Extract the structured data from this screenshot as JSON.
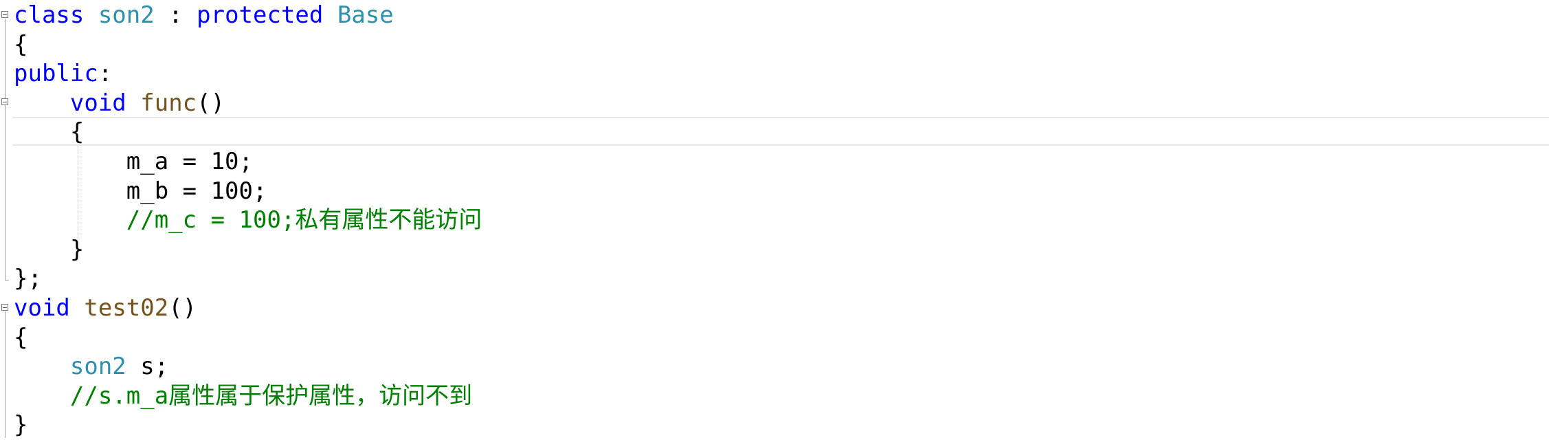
{
  "code": {
    "lines": [
      [
        {
          "t": "class ",
          "c": "kw"
        },
        {
          "t": "son2",
          "c": "type"
        },
        {
          "t": " : ",
          "c": "plain"
        },
        {
          "t": "protected",
          "c": "kw"
        },
        {
          "t": " ",
          "c": "plain"
        },
        {
          "t": "Base",
          "c": "type"
        }
      ],
      [
        {
          "t": "{",
          "c": "plain"
        }
      ],
      [
        {
          "t": "public",
          "c": "kw"
        },
        {
          "t": ":",
          "c": "plain"
        }
      ],
      [
        {
          "t": "    ",
          "c": "plain"
        },
        {
          "t": "void",
          "c": "kw"
        },
        {
          "t": " ",
          "c": "plain"
        },
        {
          "t": "func",
          "c": "fn"
        },
        {
          "t": "()",
          "c": "plain"
        }
      ],
      [
        {
          "t": "    {",
          "c": "plain"
        }
      ],
      [
        {
          "t": "        m_a = 10;",
          "c": "plain"
        }
      ],
      [
        {
          "t": "        m_b = 100;",
          "c": "plain"
        }
      ],
      [
        {
          "t": "        ",
          "c": "plain"
        },
        {
          "t": "//m_c = 100;私有属性不能访问",
          "c": "cm"
        }
      ],
      [
        {
          "t": "    }",
          "c": "plain"
        }
      ],
      [
        {
          "t": "};",
          "c": "plain"
        }
      ],
      [
        {
          "t": "void",
          "c": "kw"
        },
        {
          "t": " ",
          "c": "plain"
        },
        {
          "t": "test02",
          "c": "fn"
        },
        {
          "t": "()",
          "c": "plain"
        }
      ],
      [
        {
          "t": "{",
          "c": "plain"
        }
      ],
      [
        {
          "t": "    ",
          "c": "plain"
        },
        {
          "t": "son2",
          "c": "type"
        },
        {
          "t": " s;",
          "c": "plain"
        }
      ],
      [
        {
          "t": "    ",
          "c": "plain"
        },
        {
          "t": "//s.m_a属性属于保护属性，访问不到",
          "c": "cm"
        }
      ],
      [
        {
          "t": "}",
          "c": "plain"
        }
      ]
    ]
  },
  "theme": {
    "keyword": "#0000ff",
    "type": "#2b91af",
    "function": "#74531f",
    "comment": "#008000",
    "text": "#000000",
    "background": "#ffffff"
  }
}
